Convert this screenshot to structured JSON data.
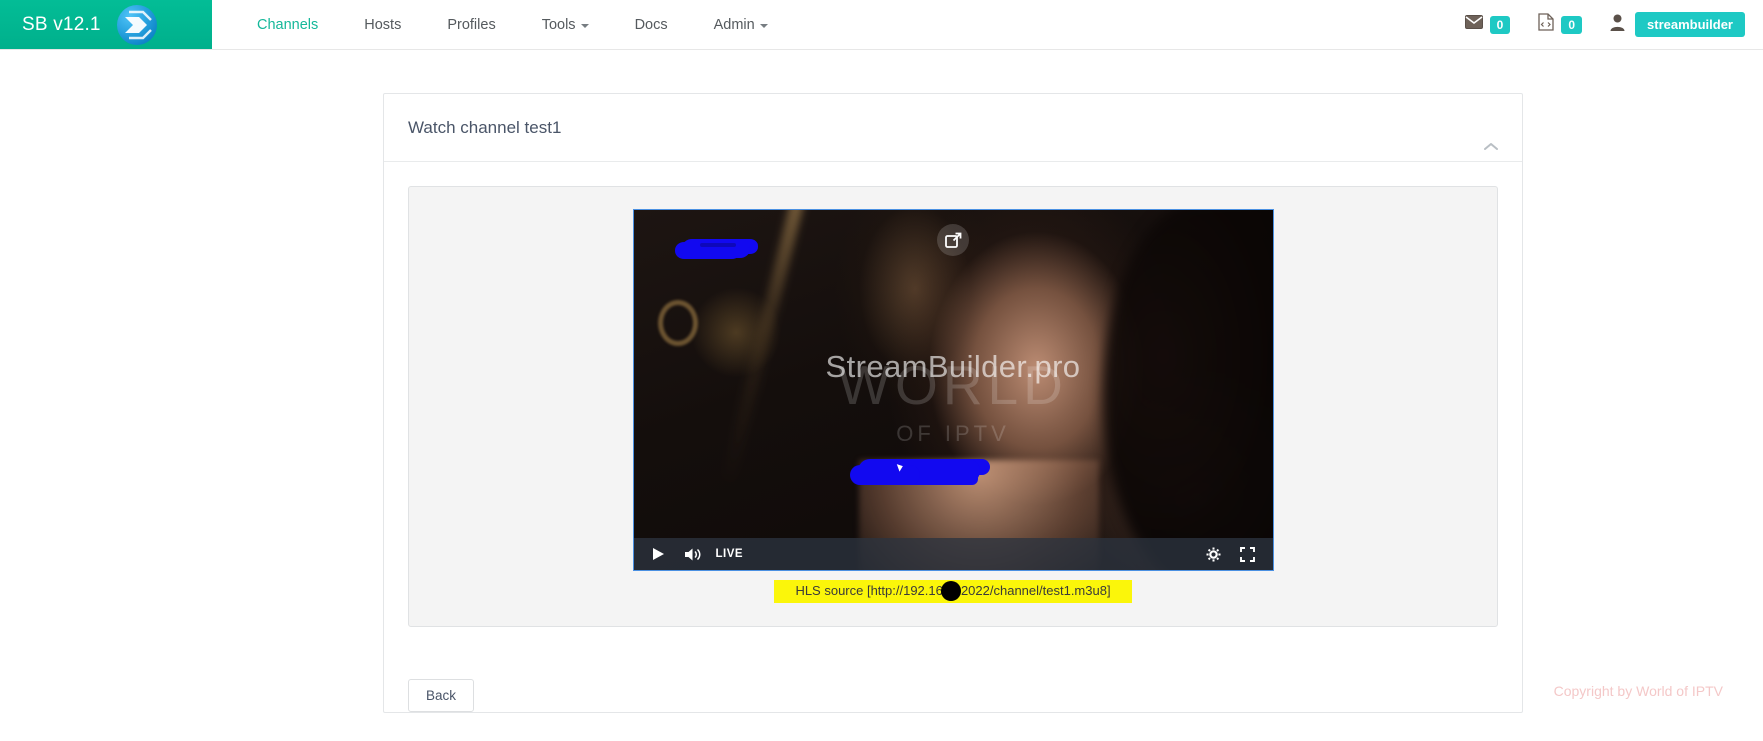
{
  "navbar": {
    "brand_label": "SB v12.1",
    "logo_icon": "streambuilder-logo-icon",
    "menu": [
      {
        "label": "Channels",
        "active": true,
        "caret": false
      },
      {
        "label": "Hosts",
        "active": false,
        "caret": false
      },
      {
        "label": "Profiles",
        "active": false,
        "caret": false
      },
      {
        "label": "Tools",
        "active": false,
        "caret": true
      },
      {
        "label": "Docs",
        "active": false,
        "caret": false
      },
      {
        "label": "Admin",
        "active": false,
        "caret": true
      }
    ],
    "mail": {
      "icon": "envelope-icon",
      "count": "0"
    },
    "logs": {
      "icon": "file-code-icon",
      "count": "0"
    },
    "user": {
      "icon": "user-icon",
      "name": "streambuilder"
    }
  },
  "panel": {
    "title": "Watch channel test1",
    "collapse_icon": "chevron-up-icon"
  },
  "player": {
    "pip_icon": "picture-in-picture-icon",
    "play_icon": "play-icon",
    "volume_icon": "volume-high-icon",
    "live_label": "LIVE",
    "settings_icon": "gear-icon",
    "fullscreen_icon": "fullscreen-icon",
    "watermark_primary": "StreamBuilder.pro",
    "watermark_secondary_main": "WORLD",
    "watermark_secondary_sub": "OF IPTV"
  },
  "hls": {
    "text_before": "HLS source [http://192.168.",
    "text_after": "22022/channel/test1.m3u8]",
    "highlight_color": "#fbf60a"
  },
  "actions": {
    "back_label": "Back"
  },
  "footer": {
    "copyright": "Copyright by World of IPTV"
  },
  "colors": {
    "brand_green": "#00b08c",
    "accent_teal": "#1ec9c4",
    "active_nav": "#15b89a",
    "redaction_blue": "#1209f0",
    "highlight_yellow": "#fbf60a",
    "footer_pink": "#f4c8c8"
  }
}
